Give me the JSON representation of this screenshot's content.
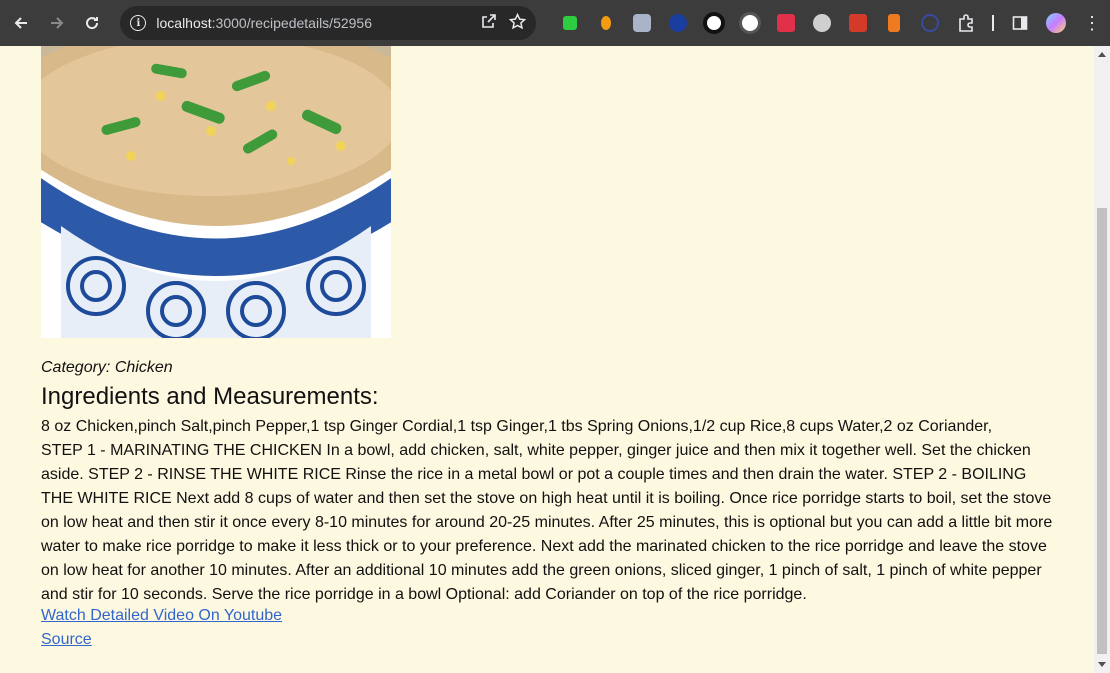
{
  "browser": {
    "url_host": "localhost",
    "url_path": ":3000/recipedetails/52956",
    "icons": [
      "back-arrow-icon",
      "forward-arrow-icon",
      "reload-icon",
      "info-icon",
      "open-external-icon",
      "bookmark-star-icon",
      "extensions-puzzle-icon",
      "side-panel-icon",
      "profile-avatar",
      "kebab-menu-icon"
    ],
    "extension_colors": [
      "#2ecc40",
      "#f39c12",
      "#aab4c8",
      "#1a3ea0",
      "#ffffff",
      "#ffffff",
      "#e0304a",
      "#cfcfcf",
      "#d43a2a",
      "#f07a20",
      "#3a4aa0"
    ]
  },
  "recipe": {
    "image_alt": "rice porridge with chicken and green onions in blue patterned bowl",
    "category": "Category: Chicken",
    "ingredients_heading": "Ingredients and Measurements:",
    "ingredients": "8 oz Chicken,pinch Salt,pinch Pepper,1 tsp Ginger Cordial,1 tsp Ginger,1 tbs Spring Onions,1/2 cup Rice,8 cups Water,2 oz Coriander,",
    "instructions": "STEP 1 - MARINATING THE CHICKEN In a bowl, add chicken, salt, white pepper, ginger juice and then mix it together well. Set the chicken aside. STEP 2 - RINSE THE WHITE RICE Rinse the rice in a metal bowl or pot a couple times and then drain the water. STEP 2 - BOILING THE WHITE RICE Next add 8 cups of water and then set the stove on high heat until it is boiling. Once rice porridge starts to boil, set the stove on low heat and then stir it once every 8-10 minutes for around 20-25 minutes. After 25 minutes, this is optional but you can add a little bit more water to make rice porridge to make it less thick or to your preference. Next add the marinated chicken to the rice porridge and leave the stove on low heat for another 10 minutes. After an additional 10 minutes add the green onions, sliced ginger, 1 pinch of salt, 1 pinch of white pepper and stir for 10 seconds. Serve the rice porridge in a bowl Optional: add Coriander on top of the rice porridge.",
    "video_link": "Watch Detailed Video On Youtube",
    "source_link": "Source"
  },
  "colors": {
    "page_bg": "#fdf8e0",
    "link": "#3366cc",
    "chrome_bg": "#3c3c3c"
  }
}
